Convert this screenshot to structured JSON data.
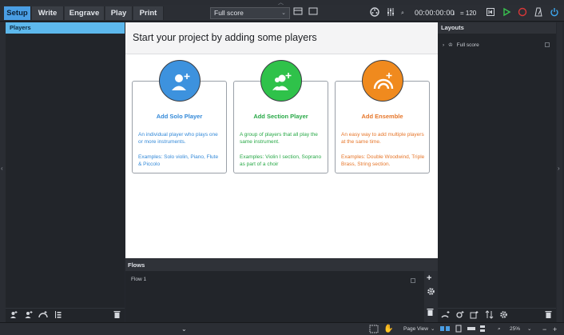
{
  "toolbar": {
    "modes": [
      "Setup",
      "Write",
      "Engrave",
      "Play",
      "Print"
    ],
    "active_mode": "Setup",
    "layout_value": "Full score",
    "time": "00:00:00:00",
    "tempo": "= 120"
  },
  "players_panel": {
    "title": "Players"
  },
  "main": {
    "heading": "Start your project by adding some players",
    "cards": [
      {
        "title": "Add Solo Player",
        "desc": "An individual player who plays one or more instruments.",
        "examples": "Examples: Solo violin, Piano, Flute & Piccolo",
        "color": "#3389d8",
        "icon_fill": "#3d92de",
        "icon": "solo-player-icon"
      },
      {
        "title": "Add Section Player",
        "desc": "A group of players that all play the same instrument.",
        "examples": "Examples: Violin I section, Soprano as part of a choir",
        "color": "#27a846",
        "icon_fill": "#2fc24a",
        "icon": "section-player-icon"
      },
      {
        "title": "Add Ensemble",
        "desc": "An easy way to add multiple players at the same time.",
        "examples": "Examples: Double Woodwind, Triple Brass, String section.",
        "color": "#e6762a",
        "icon_fill": "#f08a1e",
        "icon": "ensemble-icon"
      }
    ]
  },
  "flows_panel": {
    "title": "Flows",
    "items": [
      "Flow 1"
    ]
  },
  "layouts_panel": {
    "title": "Layouts",
    "items": [
      "Full score"
    ]
  },
  "status": {
    "view_mode": "Page View",
    "zoom": "25%"
  }
}
